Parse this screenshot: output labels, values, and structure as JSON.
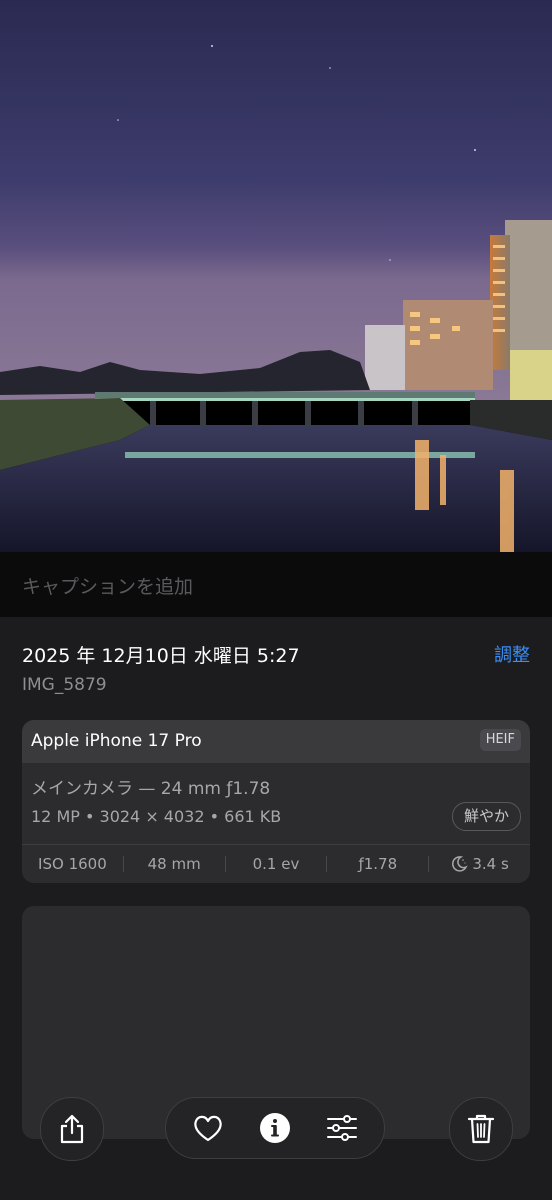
{
  "caption": {
    "placeholder": "キャプションを追加"
  },
  "info": {
    "date_time": "2025 年 12月10日 水曜日 5:27",
    "adjust_label": "調整",
    "filename": "IMG_5879"
  },
  "exif": {
    "device": "Apple iPhone 17 Pro",
    "format": "HEIF",
    "lens": "メインカメラ — 24 mm ƒ1.78",
    "specs": "12 MP • 3024 × 4032 • 661 KB",
    "photo_style": "鮮やか",
    "stats": {
      "iso": "ISO 1600",
      "focal": "48 mm",
      "ev": "0.1 ev",
      "aperture": "ƒ1.78",
      "night_mode_icon": "moon-icon",
      "shutter": "3.4 s"
    }
  },
  "toolbar": {
    "share_icon": "share-icon",
    "favorite_icon": "heart-icon",
    "info_icon": "info-icon",
    "adjust_icon": "sliders-icon",
    "delete_icon": "trash-icon"
  },
  "colors": {
    "accent": "#3b8ff6",
    "panel": "#1c1c1e",
    "card": "#2c2c2e"
  }
}
